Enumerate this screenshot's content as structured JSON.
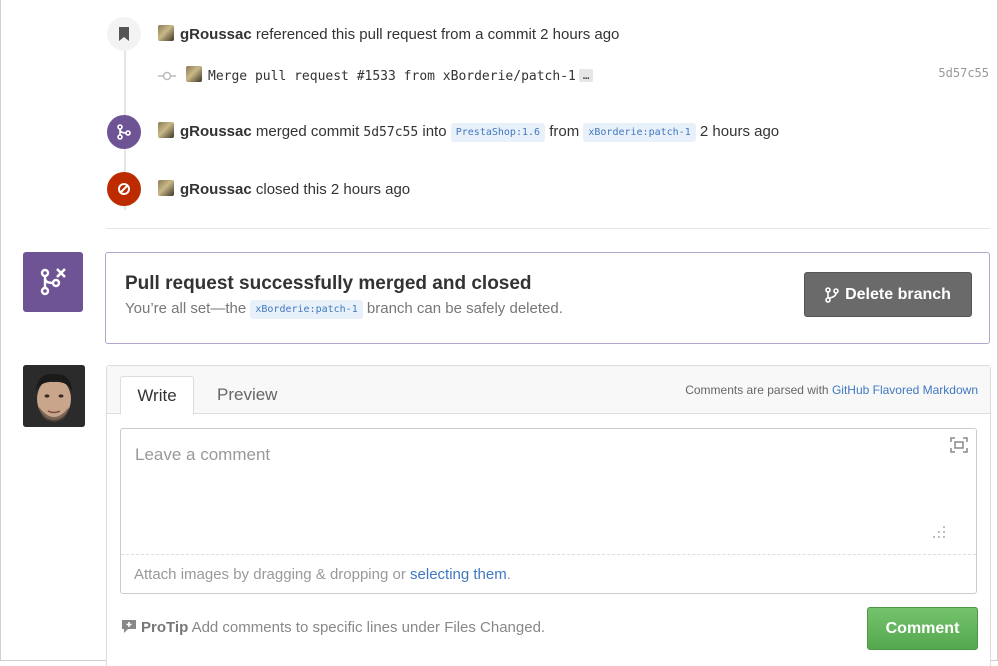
{
  "timeline": {
    "ref_event": {
      "user": "gRoussac",
      "text": "referenced this pull request from a commit 2 hours ago",
      "commit_message": "Merge pull request #1533 from xBorderie/patch-1",
      "ellipsis": "…",
      "sha": "5d57c55"
    },
    "merge_event": {
      "user": "gRoussac",
      "text_before": "merged commit",
      "sha": "5d57c55",
      "into": "into",
      "base_branch": "PrestaShop:1.6",
      "from": "from",
      "head_branch": "xBorderie:patch-1",
      "time": "2 hours ago"
    },
    "close_event": {
      "user": "gRoussac",
      "text": "closed this 2 hours ago"
    }
  },
  "merge_status": {
    "title": "Pull request successfully merged and closed",
    "sub_before": "You’re all set—the",
    "branch": "xBorderie:patch-1",
    "sub_after": "branch can be safely deleted.",
    "delete_label": "Delete branch"
  },
  "comment_form": {
    "tab_write": "Write",
    "tab_preview": "Preview",
    "parsed_prefix": "Comments are parsed with",
    "parsed_link": "GitHub Flavored Markdown",
    "placeholder": "Leave a comment",
    "attach_prefix": "Attach images by dragging & dropping or",
    "attach_link": "selecting them",
    "attach_suffix": ".",
    "protip_label": "ProTip",
    "protip_text": "Add comments to specific lines under Files Changed.",
    "submit_label": "Comment"
  },
  "colors": {
    "merged_purple": "#6e5494",
    "closed_red": "#bd2c00",
    "link_blue": "#4078c0",
    "success_green": "#55a84f"
  }
}
